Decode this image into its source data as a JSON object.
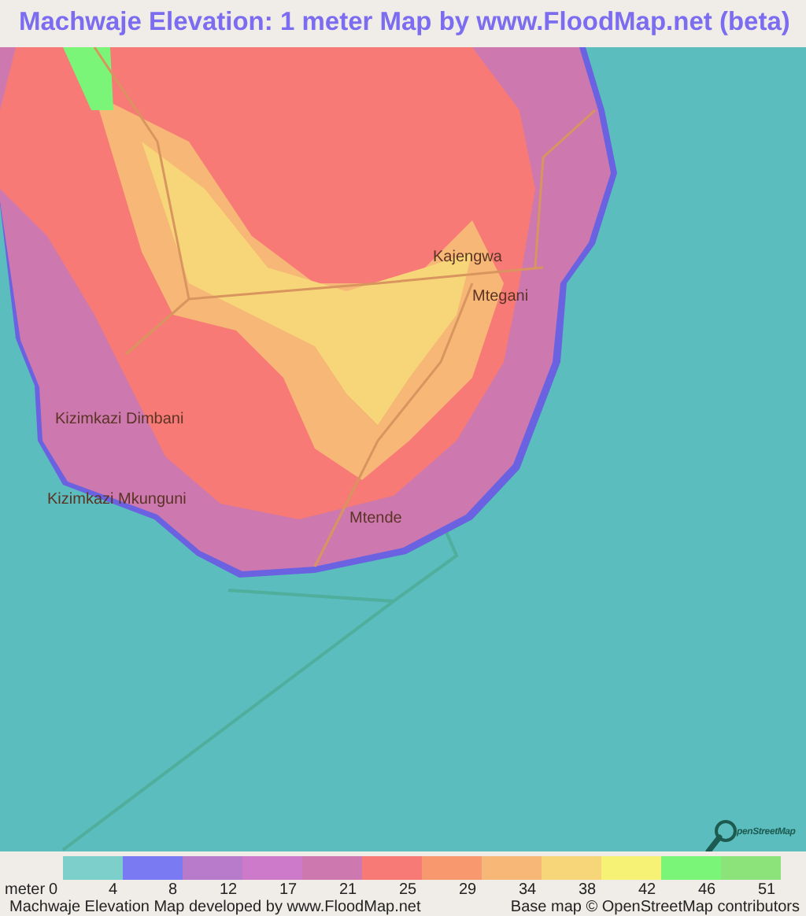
{
  "title": "Machwaje Elevation: 1 meter Map by www.FloodMap.net (beta)",
  "map": {
    "places": [
      {
        "name": "Kajengwa"
      },
      {
        "name": "Mtegani"
      },
      {
        "name": "Kizimkazi Dimbani"
      },
      {
        "name": "Kizimkazi Mkunguni"
      },
      {
        "name": "Mtende"
      }
    ],
    "logo_text": "penStreetMap"
  },
  "legend": {
    "unit": "meter",
    "swatches": [
      {
        "color": "#7ccfcb"
      },
      {
        "color": "#7a7af2"
      },
      {
        "color": "#b87acb"
      },
      {
        "color": "#cd7acb"
      },
      {
        "color": "#cd79b0"
      },
      {
        "color": "#f77a76"
      },
      {
        "color": "#f7986f"
      },
      {
        "color": "#f7b877"
      },
      {
        "color": "#f7d679"
      },
      {
        "color": "#f5f276"
      },
      {
        "color": "#7af578"
      },
      {
        "color": "#8be37a"
      }
    ],
    "labels": [
      "0",
      "4",
      "8",
      "12",
      "17",
      "21",
      "25",
      "29",
      "34",
      "38",
      "42",
      "46",
      "51"
    ]
  },
  "footer": {
    "left": "Machwaje Elevation Map developed by www.FloodMap.net",
    "right": "Base map © OpenStreetMap contributors"
  }
}
